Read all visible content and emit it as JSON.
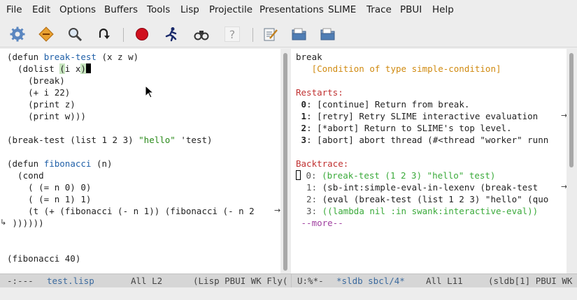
{
  "menubar": {
    "items": [
      "File",
      "Edit",
      "Options",
      "Buffers",
      "Tools",
      "Lisp",
      "Projectile",
      "Presentations",
      "SLIME",
      "Trace",
      "PBUI",
      "Help"
    ]
  },
  "toolbar": {
    "icons": [
      "gear-icon",
      "tag-icon",
      "search-icon",
      "undo-icon",
      "record-icon",
      "runner-icon",
      "binoculars-icon",
      "help-icon",
      "edit-icon",
      "folder-icon",
      "folder-icon"
    ],
    "help_glyph": "?"
  },
  "left": {
    "lines": [
      {
        "parts": [
          {
            "t": "(defun "
          },
          {
            "t": "break-test",
            "c": "fn"
          },
          {
            "t": " (x z w)"
          }
        ]
      },
      {
        "parts": [
          {
            "t": "  (dolist "
          },
          {
            "t": "(",
            "c": "par-hl"
          },
          {
            "t": "i x"
          },
          {
            "t": ")",
            "c": "par-hl"
          }
        ],
        "cursor": true
      },
      {
        "parts": [
          {
            "t": "    (break)"
          }
        ]
      },
      {
        "parts": [
          {
            "t": "    (+ i 22)"
          }
        ]
      },
      {
        "parts": [
          {
            "t": "    (print z)"
          }
        ]
      },
      {
        "parts": [
          {
            "t": "    (print w)))"
          }
        ]
      },
      {
        "parts": [
          {
            "t": ""
          }
        ]
      },
      {
        "parts": [
          {
            "t": "(break-test (list 1 2 3) "
          },
          {
            "t": "\"hello\"",
            "c": "str"
          },
          {
            "t": " 'test)"
          }
        ]
      },
      {
        "parts": [
          {
            "t": ""
          }
        ]
      },
      {
        "parts": [
          {
            "t": "(defun "
          },
          {
            "t": "fibonacci",
            "c": "fn"
          },
          {
            "t": " (n)"
          }
        ]
      },
      {
        "parts": [
          {
            "t": "  (cond"
          }
        ]
      },
      {
        "parts": [
          {
            "t": "    ( (= n 0) 0)"
          }
        ]
      },
      {
        "parts": [
          {
            "t": "    ( (= n 1) 1)"
          }
        ]
      },
      {
        "parts": [
          {
            "t": "    (t (+ (fibonacci (- n 1)) (fibonacci (- n 2"
          }
        ],
        "wrap": true
      },
      {
        "parts": [
          {
            "t": " ))))))"
          }
        ],
        "cont": true
      },
      {
        "parts": [
          {
            "t": ""
          }
        ]
      },
      {
        "parts": [
          {
            "t": ""
          }
        ]
      },
      {
        "parts": [
          {
            "t": "(fibonacci 40)"
          }
        ]
      }
    ]
  },
  "right": {
    "lines": [
      {
        "parts": [
          {
            "t": "break"
          }
        ]
      },
      {
        "parts": [
          {
            "t": "   [Condition of type simple-condition]",
            "c": "org"
          }
        ]
      },
      {
        "parts": [
          {
            "t": ""
          }
        ]
      },
      {
        "parts": [
          {
            "t": "Restarts:",
            "c": "red"
          }
        ]
      },
      {
        "parts": [
          {
            "t": " 0",
            "b": true
          },
          {
            "t": ": ["
          },
          {
            "t": "continue"
          },
          {
            "t": "] Return from break."
          }
        ]
      },
      {
        "parts": [
          {
            "t": " 1",
            "b": true
          },
          {
            "t": ": ["
          },
          {
            "t": "retry"
          },
          {
            "t": "] Retry SLIME interactive evaluation "
          }
        ],
        "wrap": true
      },
      {
        "parts": [
          {
            "t": " 2",
            "b": true
          },
          {
            "t": ": ["
          },
          {
            "t": "*abort"
          },
          {
            "t": "] Return to SLIME's top level."
          }
        ]
      },
      {
        "parts": [
          {
            "t": " 3",
            "b": true
          },
          {
            "t": ": ["
          },
          {
            "t": "abort"
          },
          {
            "t": "] abort thread (#<thread \"worker\" runn"
          }
        ]
      },
      {
        "parts": [
          {
            "t": ""
          }
        ]
      },
      {
        "parts": [
          {
            "t": "Backtrace:",
            "c": "red"
          }
        ]
      },
      {
        "parts": [
          {
            "t": " 0: ",
            "c": "dim"
          },
          {
            "t": "(break-test (1 2 3) \"hello\" test)",
            "c": "ok"
          }
        ],
        "hollow": true
      },
      {
        "parts": [
          {
            "t": "  1: ",
            "c": "dim"
          },
          {
            "t": "(sb-int:simple-eval-in-lexenv (break-test "
          }
        ],
        "wrap": true
      },
      {
        "parts": [
          {
            "t": "  2: ",
            "c": "dim"
          },
          {
            "t": "(eval (break-test (list 1 2 3) \"hello\" (quo"
          }
        ]
      },
      {
        "parts": [
          {
            "t": "  3: ",
            "c": "dim"
          },
          {
            "t": "((lambda nil :in swank:interactive-eval))",
            "c": "ok"
          }
        ]
      },
      {
        "parts": [
          {
            "t": " --more--",
            "c": "mag"
          }
        ]
      }
    ]
  },
  "modeline": {
    "left_status": "-:---",
    "left_buffer": "test.lisp",
    "left_pos": "All L2",
    "left_modes": "(Lisp PBUI WK Fly(",
    "right_status": "U:%*-",
    "right_buffer": "*sldb sbcl/4*",
    "right_pos": "All L11",
    "right_modes": "(sldb[1] PBUI WK"
  },
  "colors": {
    "function_name": "#2060a8",
    "string": "#2a8a1a",
    "heading": "#c03030",
    "condition": "#d08a10",
    "more": "#a040a0",
    "buffer_name": "#3b6a9e"
  }
}
